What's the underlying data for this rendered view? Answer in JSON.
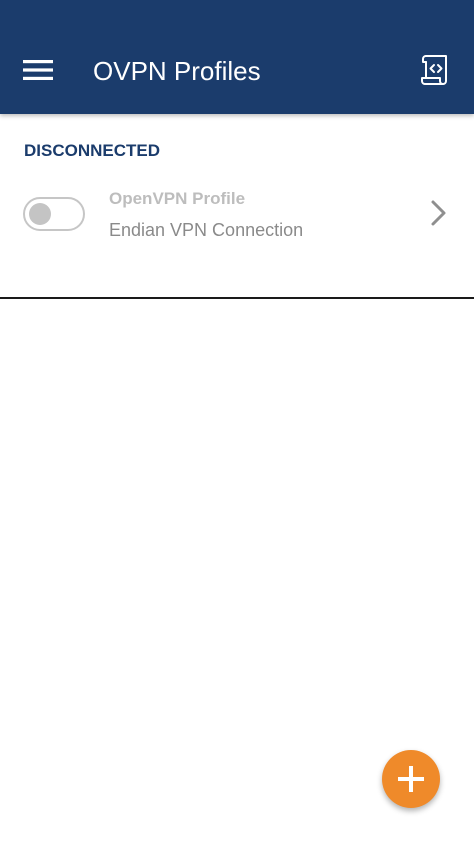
{
  "app_bar": {
    "title": "OVPN Profiles",
    "background_color": "#1b3c6c",
    "menu_icon": "hamburger-menu-icon",
    "import_icon": "script-code-icon"
  },
  "section": {
    "header": "DISCONNECTED",
    "header_color": "#1b3c6c"
  },
  "profiles": [
    {
      "name": "OpenVPN Profile",
      "description": "Endian VPN Connection",
      "connected": false
    }
  ],
  "fab": {
    "icon": "plus-icon",
    "color": "#ef8a2a"
  }
}
